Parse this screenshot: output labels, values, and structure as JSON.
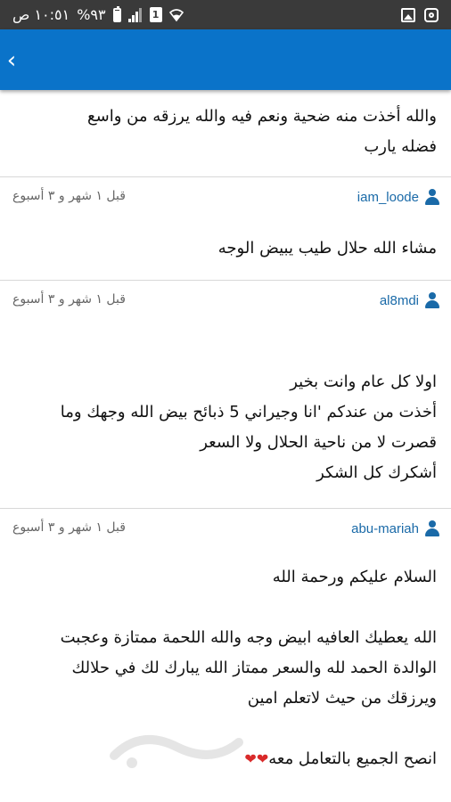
{
  "status_bar": {
    "time": "١٠:٥١ ص",
    "battery_percent": "%٩٣",
    "sim_label": "1",
    "icons": [
      "battery-icon",
      "signal-icon",
      "sim-icon",
      "wifi-icon",
      "instagram-icon",
      "gallery-icon"
    ]
  },
  "header": {
    "back_glyph": "‹",
    "color": "#0a73c9"
  },
  "posts": {
    "top_text": "والله أخذت منه  ضحية  ونعم فيه والله  يرزقه من واسع\nفضله يارب"
  },
  "comments": [
    {
      "user": "iam_loode",
      "time": "قبل ١ شهر و ٣ أسبوع",
      "text": "مشاء الله حلال طيب يبيض الوجه"
    },
    {
      "user": "al8mdi",
      "time": "قبل ١ شهر و ٣ أسبوع",
      "text": "اولا كل عام وانت بخير\nأخذت من عندكم 'انا وجيراني 5 ذبائح بيض الله وجهك وما\nقصرت لا من ناحية الحلال ولا السعر\nأشكرك كل الشكر"
    },
    {
      "user": "abu-mariah",
      "time": "قبل ١ شهر و ٣ أسبوع",
      "text": "السلام عليكم ورحمة الله\n\nالله يعطيك العافيه ابيض وجه والله اللحمة ممتازة وعجبت\nالوالدة الحمد لله والسعر ممتاز الله يبارك لك في حلالك\nويرزقك من حيث لاتعلم امين\n\nانصح الجميع بالتعامل معه",
      "hearts": "❤❤"
    }
  ]
}
